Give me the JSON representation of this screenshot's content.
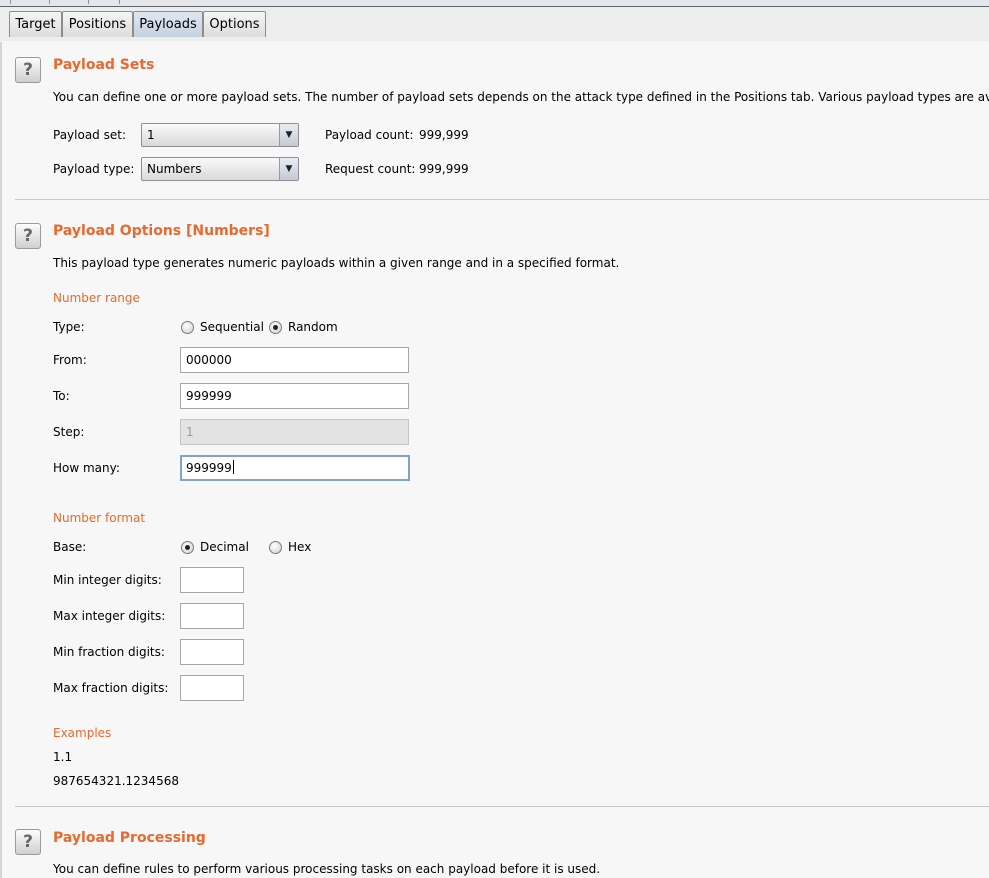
{
  "tabs": [
    "Target",
    "Positions",
    "Payloads",
    "Options"
  ],
  "active_tab": "Payloads",
  "payload_sets": {
    "title": "Payload Sets",
    "description": "You can define one or more payload sets. The number of payload sets depends on the attack type defined in the Positions tab. Various payload types are available",
    "payload_set_label": "Payload set:",
    "payload_set_value": "1",
    "payload_type_label": "Payload type:",
    "payload_type_value": "Numbers",
    "payload_count_label": "Payload count:",
    "payload_count_value": "999,999",
    "request_count_label": "Request count:",
    "request_count_value": "999,999"
  },
  "payload_options": {
    "title": "Payload Options [Numbers]",
    "description": "This payload type generates numeric payloads within a given range and in a specified format.",
    "number_range": {
      "title": "Number range",
      "type_label": "Type:",
      "sequential_label": "Sequential",
      "random_label": "Random",
      "selected": "Random",
      "from_label": "From:",
      "from_value": "000000",
      "to_label": "To:",
      "to_value": "999999",
      "step_label": "Step:",
      "step_value": "1",
      "how_many_label": "How many:",
      "how_many_value": "999999"
    },
    "number_format": {
      "title": "Number format",
      "base_label": "Base:",
      "decimal_label": "Decimal",
      "hex_label": "Hex",
      "selected": "Decimal",
      "min_int_label": "Min integer digits:",
      "min_int_value": "",
      "max_int_label": "Max integer digits:",
      "max_int_value": "",
      "min_frac_label": "Min fraction digits:",
      "min_frac_value": "",
      "max_frac_label": "Max fraction digits:",
      "max_frac_value": ""
    },
    "examples": {
      "title": "Examples",
      "items": [
        "1.1",
        "987654321.1234568"
      ]
    }
  },
  "payload_processing": {
    "title": "Payload Processing",
    "description": "You can define rules to perform various processing tasks on each payload before it is used."
  },
  "colors": {
    "accent": "#e8692d",
    "tab_active": "#c7d2e0",
    "focus_border": "#7fa6c8"
  },
  "icons": {
    "help": "help-question-icon",
    "dropdown": "chevron-down-icon"
  }
}
